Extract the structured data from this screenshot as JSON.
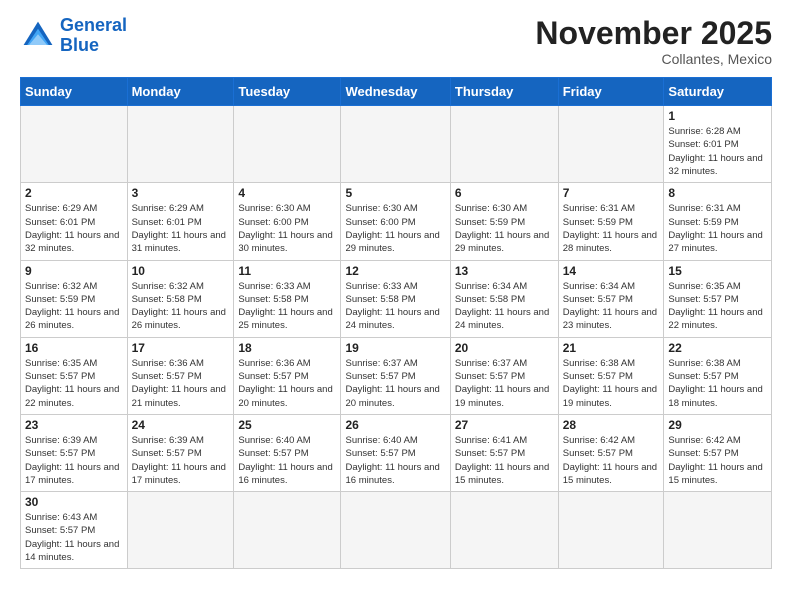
{
  "logo": {
    "line1": "General",
    "line2": "Blue"
  },
  "title": "November 2025",
  "subtitle": "Collantes, Mexico",
  "weekdays": [
    "Sunday",
    "Monday",
    "Tuesday",
    "Wednesday",
    "Thursday",
    "Friday",
    "Saturday"
  ],
  "days": {
    "1": {
      "sunrise": "6:28 AM",
      "sunset": "6:01 PM",
      "daylight": "11 hours and 32 minutes."
    },
    "2": {
      "sunrise": "6:29 AM",
      "sunset": "6:01 PM",
      "daylight": "11 hours and 32 minutes."
    },
    "3": {
      "sunrise": "6:29 AM",
      "sunset": "6:01 PM",
      "daylight": "11 hours and 31 minutes."
    },
    "4": {
      "sunrise": "6:30 AM",
      "sunset": "6:00 PM",
      "daylight": "11 hours and 30 minutes."
    },
    "5": {
      "sunrise": "6:30 AM",
      "sunset": "6:00 PM",
      "daylight": "11 hours and 29 minutes."
    },
    "6": {
      "sunrise": "6:30 AM",
      "sunset": "5:59 PM",
      "daylight": "11 hours and 29 minutes."
    },
    "7": {
      "sunrise": "6:31 AM",
      "sunset": "5:59 PM",
      "daylight": "11 hours and 28 minutes."
    },
    "8": {
      "sunrise": "6:31 AM",
      "sunset": "5:59 PM",
      "daylight": "11 hours and 27 minutes."
    },
    "9": {
      "sunrise": "6:32 AM",
      "sunset": "5:59 PM",
      "daylight": "11 hours and 26 minutes."
    },
    "10": {
      "sunrise": "6:32 AM",
      "sunset": "5:58 PM",
      "daylight": "11 hours and 26 minutes."
    },
    "11": {
      "sunrise": "6:33 AM",
      "sunset": "5:58 PM",
      "daylight": "11 hours and 25 minutes."
    },
    "12": {
      "sunrise": "6:33 AM",
      "sunset": "5:58 PM",
      "daylight": "11 hours and 24 minutes."
    },
    "13": {
      "sunrise": "6:34 AM",
      "sunset": "5:58 PM",
      "daylight": "11 hours and 24 minutes."
    },
    "14": {
      "sunrise": "6:34 AM",
      "sunset": "5:57 PM",
      "daylight": "11 hours and 23 minutes."
    },
    "15": {
      "sunrise": "6:35 AM",
      "sunset": "5:57 PM",
      "daylight": "11 hours and 22 minutes."
    },
    "16": {
      "sunrise": "6:35 AM",
      "sunset": "5:57 PM",
      "daylight": "11 hours and 22 minutes."
    },
    "17": {
      "sunrise": "6:36 AM",
      "sunset": "5:57 PM",
      "daylight": "11 hours and 21 minutes."
    },
    "18": {
      "sunrise": "6:36 AM",
      "sunset": "5:57 PM",
      "daylight": "11 hours and 20 minutes."
    },
    "19": {
      "sunrise": "6:37 AM",
      "sunset": "5:57 PM",
      "daylight": "11 hours and 20 minutes."
    },
    "20": {
      "sunrise": "6:37 AM",
      "sunset": "5:57 PM",
      "daylight": "11 hours and 19 minutes."
    },
    "21": {
      "sunrise": "6:38 AM",
      "sunset": "5:57 PM",
      "daylight": "11 hours and 19 minutes."
    },
    "22": {
      "sunrise": "6:38 AM",
      "sunset": "5:57 PM",
      "daylight": "11 hours and 18 minutes."
    },
    "23": {
      "sunrise": "6:39 AM",
      "sunset": "5:57 PM",
      "daylight": "11 hours and 17 minutes."
    },
    "24": {
      "sunrise": "6:39 AM",
      "sunset": "5:57 PM",
      "daylight": "11 hours and 17 minutes."
    },
    "25": {
      "sunrise": "6:40 AM",
      "sunset": "5:57 PM",
      "daylight": "11 hours and 16 minutes."
    },
    "26": {
      "sunrise": "6:40 AM",
      "sunset": "5:57 PM",
      "daylight": "11 hours and 16 minutes."
    },
    "27": {
      "sunrise": "6:41 AM",
      "sunset": "5:57 PM",
      "daylight": "11 hours and 15 minutes."
    },
    "28": {
      "sunrise": "6:42 AM",
      "sunset": "5:57 PM",
      "daylight": "11 hours and 15 minutes."
    },
    "29": {
      "sunrise": "6:42 AM",
      "sunset": "5:57 PM",
      "daylight": "11 hours and 15 minutes."
    },
    "30": {
      "sunrise": "6:43 AM",
      "sunset": "5:57 PM",
      "daylight": "11 hours and 14 minutes."
    }
  },
  "labels": {
    "sunrise": "Sunrise:",
    "sunset": "Sunset:",
    "daylight": "Daylight:"
  }
}
